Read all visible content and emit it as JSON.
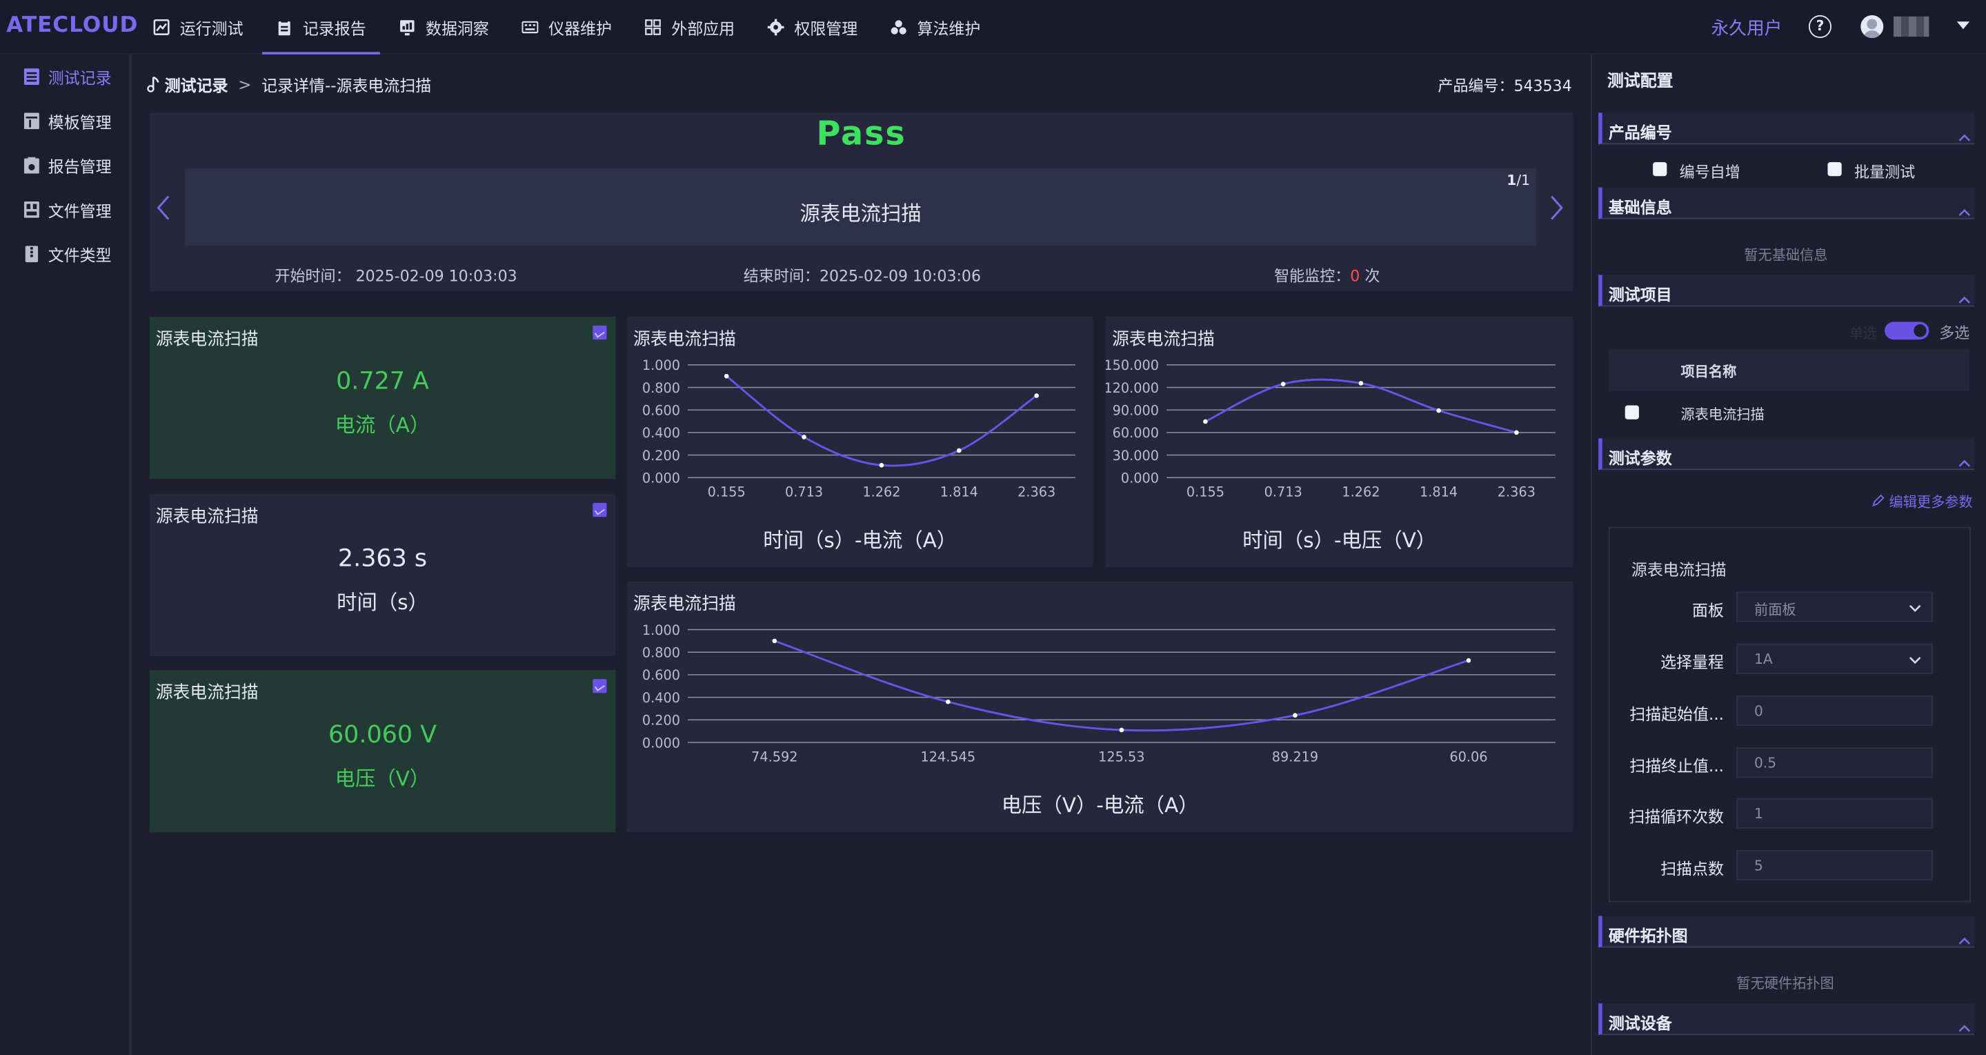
{
  "app": {
    "brand": "ATECLOUD",
    "user_label": "永久用户",
    "help_icon": "?"
  },
  "nav": [
    {
      "label": "运行测试",
      "icon": "chart-line-icon",
      "active": false
    },
    {
      "label": "记录报告",
      "icon": "clipboard-icon",
      "active": true
    },
    {
      "label": "数据洞察",
      "icon": "insight-icon",
      "active": false
    },
    {
      "label": "仪器维护",
      "icon": "keyboard-icon",
      "active": false
    },
    {
      "label": "外部应用",
      "icon": "grid-icon",
      "active": false
    },
    {
      "label": "权限管理",
      "icon": "cog-icon",
      "active": false
    },
    {
      "label": "算法维护",
      "icon": "cluster-icon",
      "active": false
    }
  ],
  "sidebar": [
    {
      "label": "测试记录",
      "icon": "record-icon",
      "active": true
    },
    {
      "label": "模板管理",
      "icon": "template-icon",
      "active": false
    },
    {
      "label": "报告管理",
      "icon": "report-icon",
      "active": false
    },
    {
      "label": "文件管理",
      "icon": "file-icon",
      "active": false
    },
    {
      "label": "文件类型",
      "icon": "filetype-icon",
      "active": false
    }
  ],
  "breadcrumb": {
    "root": "测试记录",
    "sep": ">",
    "current": "记录详情--源表电流扫描"
  },
  "product_no": "产品编号：543534",
  "hero": {
    "result": "Pass",
    "strip_title": "源表电流扫描",
    "pager_current": "1",
    "pager_total": "/1",
    "start_time": "开始时间：  2025-02-09 10:03:03",
    "end_time": "结束时间：2025-02-09 10:03:06",
    "monitor_label": "智能监控：",
    "monitor_count": "0",
    "monitor_unit": " 次"
  },
  "tiles": [
    {
      "title": "源表电流扫描",
      "value": "0.727  A",
      "unit": "电流（A）"
    },
    {
      "title": "源表电流扫描",
      "value": "2.363  s",
      "unit": "时间（s）"
    },
    {
      "title": "源表电流扫描",
      "value": "60.060  V",
      "unit": "电压（V）"
    }
  ],
  "chart_data": [
    {
      "type": "line",
      "title": "源表电流扫描",
      "xlabel": "时间（s）-电流（A）",
      "categories": [
        "0.155",
        "0.713",
        "1.262",
        "1.814",
        "2.363"
      ],
      "values": [
        0.9,
        0.36,
        0.11,
        0.24,
        0.727
      ],
      "ylim": [
        0,
        1.0
      ],
      "yticks": [
        "1.000",
        "0.800",
        "0.600",
        "0.400",
        "0.200",
        "0.000"
      ],
      "grid": true,
      "color": "#6b52e6"
    },
    {
      "type": "line",
      "title": "源表电流扫描",
      "xlabel": "时间（s）-电压（V）",
      "categories": [
        "0.155",
        "0.713",
        "1.262",
        "1.814",
        "2.363"
      ],
      "values": [
        74.592,
        124.545,
        125.53,
        89.219,
        60.06
      ],
      "ylim": [
        0,
        150
      ],
      "yticks": [
        "150.000",
        "120.000",
        "90.000",
        "60.000",
        "30.000",
        "0.000"
      ],
      "grid": true,
      "color": "#6b52e6"
    },
    {
      "type": "line",
      "title": "源表电流扫描",
      "xlabel": "电压（V）-电流（A）",
      "categories": [
        "74.592",
        "124.545",
        "125.53",
        "89.219",
        "60.06"
      ],
      "values": [
        0.9,
        0.36,
        0.11,
        0.24,
        0.727
      ],
      "ylim": [
        0,
        1.0
      ],
      "yticks": [
        "1.000",
        "0.800",
        "0.600",
        "0.400",
        "0.200",
        "0.000"
      ],
      "grid": true,
      "color": "#6b52e6"
    }
  ],
  "config": {
    "heading": "测试配置",
    "sections": {
      "product": "产品编号",
      "basic": "基础信息",
      "items": "测试项目",
      "params": "测试参数",
      "topology": "硬件拓扑图",
      "devices": "测试设备"
    },
    "auto_increment": "编号自增",
    "batch_test": "批量测试",
    "no_basic": "暂无基础信息",
    "multi_select": "多选",
    "single_select": "单选",
    "col_name": "项目名称",
    "item_row": "源表电流扫描",
    "edit_more": "编辑更多参数",
    "param_group": "源表电流扫描",
    "params": [
      {
        "label": "面板",
        "value": "前面板",
        "dropdown": true
      },
      {
        "label": "选择量程",
        "value": "1A",
        "dropdown": true
      },
      {
        "label": "扫描起始值...",
        "value": "0",
        "dropdown": false
      },
      {
        "label": "扫描终止值...",
        "value": "0.5",
        "dropdown": false
      },
      {
        "label": "扫描循环次数",
        "value": "1",
        "dropdown": false
      },
      {
        "label": "扫描点数",
        "value": "5",
        "dropdown": false
      }
    ],
    "no_topology": "暂无硬件拓扑图"
  }
}
